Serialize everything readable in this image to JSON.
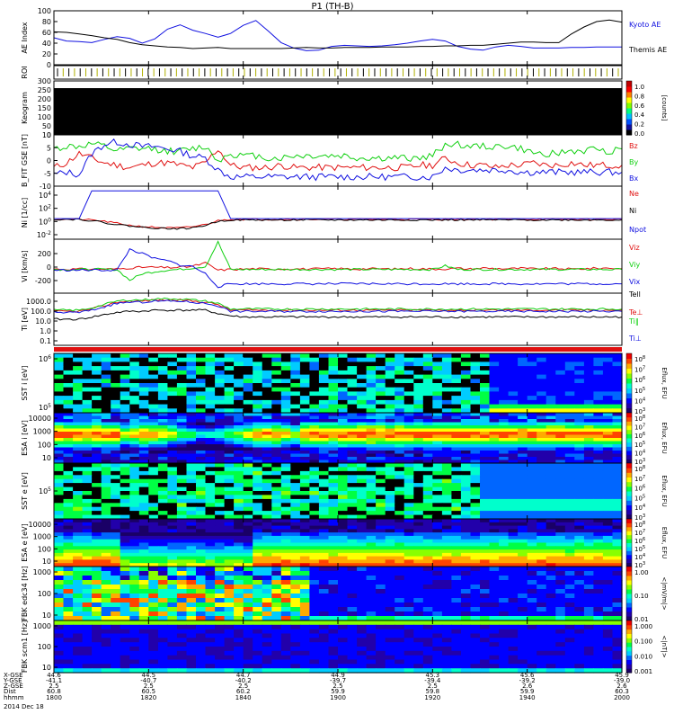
{
  "title": "P1 (TH-B)",
  "colors": {
    "blue": "#1010e0",
    "red": "#e01010",
    "green": "#10d010",
    "black": "#000000",
    "magenta": "#ff00ff",
    "yellow": "#d8d800"
  },
  "chart_data": [
    {
      "name": "ae-index",
      "type": "line",
      "ylabel": "AE Index",
      "ylim": [
        0,
        100
      ],
      "yticks": [
        "100",
        "80",
        "60",
        "40",
        "20",
        "0"
      ],
      "series": [
        {
          "name": "Kyoto AE",
          "color": "blue",
          "values": [
            50,
            44,
            43,
            41,
            47,
            52,
            49,
            40,
            48,
            66,
            74,
            64,
            58,
            51,
            58,
            73,
            82,
            62,
            41,
            31,
            26,
            27,
            34,
            36,
            35,
            34,
            35,
            37,
            40,
            44,
            47,
            44,
            34,
            29,
            27,
            33,
            36,
            34,
            31,
            31,
            31,
            32,
            32,
            33,
            33,
            33
          ]
        },
        {
          "name": "Themis AE",
          "color": "black",
          "values": [
            61,
            60,
            57,
            54,
            50,
            47,
            41,
            37,
            35,
            33,
            32,
            30,
            31,
            32,
            30,
            30,
            30,
            30,
            30,
            31,
            32,
            31,
            31,
            32,
            32,
            32,
            33,
            33,
            33,
            34,
            34,
            35,
            35,
            36,
            36,
            38,
            40,
            42,
            42,
            41,
            41,
            57,
            70,
            80,
            83,
            79
          ]
        }
      ]
    },
    {
      "name": "roi",
      "type": "table",
      "ylabel": "ROI"
    },
    {
      "name": "keogram",
      "type": "heatmap",
      "ylabel": "Keogram",
      "yticks": [
        "300",
        "250",
        "200",
        "150",
        "100",
        "50",
        "0"
      ],
      "colorbar": {
        "ticks": [
          "1.0",
          "0.8",
          "0.6",
          "0.4",
          "0.2",
          "0.0"
        ],
        "label": "[counts]"
      }
    },
    {
      "name": "b-field",
      "type": "line",
      "ylabel": "B_FIT GSE [nT]",
      "yticks": [
        "10",
        "5",
        "0",
        "-5",
        "-10"
      ],
      "series": [
        {
          "name": "Bz",
          "color": "red",
          "values": [
            -3,
            -1,
            3,
            1,
            -1,
            -2,
            -3,
            -2,
            -1,
            -1,
            -2,
            -3,
            -1,
            5,
            -2,
            -3,
            -3,
            -3,
            -2,
            -3,
            -3,
            -3,
            -3,
            -3,
            -3,
            -3,
            -3,
            -3,
            -3,
            -2,
            -2,
            1,
            -1,
            -2,
            -2,
            -3,
            -2,
            -2,
            -1,
            -2,
            -2,
            -1,
            -2,
            -2,
            -2,
            -2
          ]
        },
        {
          "name": "By",
          "color": "green",
          "values": [
            5,
            6,
            6,
            7,
            6,
            4,
            5,
            5,
            5,
            4,
            4,
            5,
            6,
            0,
            3,
            2,
            2,
            1,
            1,
            2,
            2,
            2,
            2,
            2,
            1,
            1,
            1,
            1,
            1,
            1,
            2,
            7,
            7,
            6,
            6,
            6,
            6,
            5,
            3,
            3,
            3,
            4,
            4,
            5,
            4,
            5
          ]
        },
        {
          "name": "Bx",
          "color": "blue",
          "values": [
            -6,
            -5,
            -6,
            3,
            7,
            8,
            7,
            6,
            6,
            5,
            4,
            2,
            1,
            -4,
            -7,
            -7,
            -7,
            -7,
            -7,
            -7,
            -7,
            -7,
            -7,
            -7,
            -7,
            -7,
            -7,
            -7,
            -7,
            -7,
            -7,
            -3,
            -4,
            -4,
            -4,
            -4,
            -4,
            -5,
            -5,
            -5,
            -5,
            -5,
            -5,
            -5,
            -5,
            -5
          ]
        }
      ]
    },
    {
      "name": "density",
      "type": "line",
      "ylabel": "Ni [1/cc]",
      "yunit": "[1/cc]",
      "yticks": [
        "10^4",
        "10^2",
        "10^0",
        "10^-2"
      ],
      "series": [
        {
          "name": "Ne",
          "color": "red",
          "values": [
            0,
            0,
            0,
            -0.1,
            -0.3,
            -0.6,
            -0.9,
            -1.1,
            -1.2,
            -1.3,
            -1.3,
            -1.1,
            -0.8,
            -0.2,
            0,
            0,
            0,
            0,
            0,
            0,
            0,
            0,
            0,
            0,
            0,
            0,
            0,
            0,
            0,
            0,
            0,
            0,
            0,
            0,
            0,
            0,
            0,
            0,
            0,
            0,
            0,
            0,
            0,
            0,
            0,
            0
          ]
        },
        {
          "name": "Ni",
          "color": "black",
          "values": [
            0,
            0,
            0,
            -0.2,
            -0.5,
            -0.8,
            -1.0,
            -1.2,
            -1.3,
            -1.4,
            -1.4,
            -1.3,
            -0.9,
            -0.3,
            -0.1,
            -0.1,
            -0.1,
            -0.1,
            -0.1,
            -0.1,
            -0.1,
            -0.1,
            -0.1,
            -0.1,
            -0.1,
            -0.1,
            -0.1,
            -0.1,
            -0.1,
            -0.1,
            -0.1,
            -0.1,
            -0.1,
            -0.1,
            -0.1,
            -0.1,
            -0.1,
            -0.1,
            -0.1,
            -0.1,
            -0.1,
            -0.1,
            -0.1,
            -0.1,
            -0.1,
            -0.1
          ]
        },
        {
          "name": "Npot",
          "color": "blue",
          "values": [
            0.1,
            0.1,
            0.1,
            4.3,
            4.3,
            4.3,
            4.3,
            4.3,
            4.3,
            4.3,
            4.3,
            4.3,
            4.3,
            4.3,
            0.1,
            0.1,
            0.1,
            0.1,
            0.1,
            0.1,
            0.1,
            0.1,
            0.1,
            0.1,
            0.1,
            0.1,
            0.1,
            0.1,
            0.1,
            0.1,
            0.1,
            0.1,
            0.1,
            0.1,
            0.1,
            0.1,
            0.1,
            0.1,
            0.1,
            0.1,
            0.1,
            0.1,
            0.1,
            0.1,
            0.1,
            0.1
          ]
        }
      ]
    },
    {
      "name": "velocity",
      "type": "line",
      "ylabel": "Vi [km/s]",
      "yticks": [
        "200",
        "0",
        "-200"
      ],
      "series": [
        {
          "name": "Viz",
          "color": "red",
          "values": [
            5,
            4,
            5,
            3,
            4,
            6,
            20,
            30,
            30,
            25,
            30,
            45,
            90,
            -10,
            0,
            5,
            10,
            5,
            8,
            10,
            5,
            8,
            12,
            10,
            5,
            10,
            8,
            5,
            12,
            10,
            5,
            8,
            15,
            5,
            20,
            12,
            10,
            15,
            8,
            10,
            12,
            5,
            10,
            15,
            20,
            10
          ]
        },
        {
          "name": "Viy",
          "color": "green",
          "values": [
            0,
            -2,
            0,
            2,
            0,
            -2,
            -150,
            -60,
            -30,
            -10,
            0,
            20,
            40,
            380,
            0,
            0,
            0,
            0,
            0,
            0,
            0,
            0,
            0,
            0,
            0,
            0,
            0,
            0,
            0,
            0,
            0,
            50,
            0,
            0,
            0,
            0,
            0,
            0,
            0,
            0,
            0,
            0,
            0,
            0,
            0,
            0
          ]
        },
        {
          "name": "Vix",
          "color": "blue",
          "values": [
            -10,
            -10,
            -10,
            -10,
            -10,
            -10,
            280,
            220,
            150,
            120,
            60,
            40,
            -60,
            -240,
            -200,
            -200,
            -200,
            -200,
            -200,
            -200,
            -200,
            -200,
            -200,
            -200,
            -200,
            -200,
            -200,
            -200,
            -200,
            -200,
            -200,
            -200,
            -200,
            -200,
            -200,
            -200,
            -200,
            -200,
            -200,
            -200,
            -200,
            -200,
            -200,
            -200,
            -200,
            -200
          ]
        }
      ]
    },
    {
      "name": "temperature",
      "type": "line",
      "ylabel": "Ti [eV]",
      "yticks": [
        "1000.0",
        "100.0",
        "10.0",
        "1.0",
        "0.1"
      ],
      "series": [
        {
          "name": "Tell",
          "color": "black",
          "values": [
            1.0,
            1.0,
            1.0,
            1.2,
            1.4,
            1.6,
            1.7,
            1.7,
            1.8,
            1.8,
            1.8,
            1.8,
            1.8,
            1.5,
            1.3,
            1.2,
            1.2,
            1.2,
            1.2,
            1.2,
            1.2,
            1.2,
            1.2,
            1.2,
            1.2,
            1.2,
            1.2,
            1.2,
            1.2,
            1.2,
            1.2,
            1.2,
            1.2,
            1.2,
            1.2,
            1.2,
            1.2,
            1.2,
            1.2,
            1.2,
            1.2,
            1.2,
            1.2,
            1.2,
            1.2,
            1.2
          ]
        },
        {
          "name": "Te⊥",
          "color": "red",
          "values": [
            1.7,
            1.7,
            1.7,
            1.9,
            2.2,
            2.5,
            2.6,
            2.6,
            2.7,
            2.7,
            2.7,
            2.6,
            2.5,
            2.3,
            1.8,
            1.8,
            1.8,
            1.8,
            1.8,
            1.8,
            1.8,
            1.8,
            1.8,
            1.8,
            1.8,
            1.8,
            1.8,
            1.8,
            1.8,
            1.8,
            1.8,
            1.8,
            1.8,
            1.8,
            1.8,
            1.8,
            1.8,
            1.8,
            1.8,
            1.8,
            1.8,
            1.8,
            1.8,
            1.8,
            1.8,
            1.8
          ]
        },
        {
          "name": "Ti‖",
          "color": "green",
          "values": [
            1.8,
            1.8,
            1.8,
            2.0,
            2.3,
            2.6,
            2.7,
            2.7,
            2.8,
            2.8,
            2.8,
            2.7,
            2.6,
            2.4,
            1.9,
            1.9,
            1.9,
            1.9,
            1.9,
            1.9,
            1.9,
            1.9,
            1.9,
            1.9,
            1.9,
            1.9,
            1.9,
            1.9,
            1.9,
            1.9,
            1.9,
            1.9,
            1.9,
            1.9,
            1.9,
            1.9,
            1.9,
            1.9,
            1.9,
            1.9,
            1.9,
            1.9,
            1.9,
            1.9,
            1.9,
            1.9
          ]
        },
        {
          "name": "Ti⊥",
          "color": "blue",
          "values": [
            1.6,
            1.6,
            1.6,
            1.8,
            2.1,
            2.4,
            2.5,
            2.5,
            2.6,
            2.6,
            2.6,
            2.5,
            2.4,
            2.2,
            1.7,
            1.7,
            1.7,
            1.7,
            1.7,
            1.7,
            1.7,
            1.7,
            1.7,
            1.7,
            1.7,
            1.7,
            1.7,
            1.7,
            1.7,
            1.7,
            1.7,
            1.7,
            1.7,
            1.7,
            1.7,
            1.7,
            1.7,
            1.7,
            1.7,
            1.7,
            1.7,
            1.7,
            1.7,
            1.7,
            1.7,
            1.7
          ]
        }
      ]
    },
    {
      "name": "sst-i",
      "type": "heatmap",
      "ylabel": "SST i [eV]",
      "yticks": [
        "10^6",
        "10^5"
      ],
      "colorbar": {
        "ticks": [
          "10^8",
          "10^7",
          "10^6",
          "10^5",
          "10^4",
          "10^3"
        ],
        "label": "Eflux, EFU"
      }
    },
    {
      "name": "esa-i",
      "type": "heatmap",
      "ylabel": "ESA i [eV]",
      "yticks": [
        "10000",
        "1000",
        "100",
        "10"
      ],
      "colorbar": {
        "ticks": [
          "10^8",
          "10^7",
          "10^6",
          "10^5",
          "10^4",
          "10^3"
        ],
        "label": "Eflux, EFU"
      }
    },
    {
      "name": "sst-e",
      "type": "heatmap",
      "ylabel": "SST e [eV]",
      "yticks": [
        "10^5"
      ],
      "colorbar": {
        "ticks": [
          "10^8",
          "10^7",
          "10^6",
          "10^5",
          "10^4",
          "10^3"
        ],
        "label": "Eflux, EFU"
      }
    },
    {
      "name": "esa-e",
      "type": "heatmap",
      "ylabel": "ESA e [eV]",
      "yticks": [
        "10000",
        "1000",
        "100",
        "10"
      ],
      "colorbar": {
        "ticks": [
          "10^8",
          "10^7",
          "10^6",
          "10^5",
          "10^4",
          "10^3"
        ],
        "label": "Eflux, EFU"
      }
    },
    {
      "name": "fbk-e",
      "type": "heatmap",
      "ylabel": "FBK edc34 [Hz]",
      "yticks": [
        "1000",
        "100",
        "10"
      ],
      "colorbar": {
        "ticks": [
          "1.00",
          "0.10",
          "0.01"
        ],
        "label": "<|mV/m|>"
      }
    },
    {
      "name": "fbk-b",
      "type": "heatmap",
      "ylabel": "FBK scm1 [Hz]",
      "yticks": [
        "1000",
        "100",
        "10"
      ],
      "colorbar": {
        "ticks": [
          "1.000",
          "0.100",
          "0.010",
          "0.001"
        ],
        "label": "<|nT|>"
      }
    }
  ],
  "xaxis": {
    "row_labels": [
      "X-GSE",
      "Y-GSE",
      "Z-GSE",
      "Dist",
      "hhmm"
    ],
    "columns": [
      {
        "x": "44.6",
        "y": "-41.1",
        "z": "2.5",
        "d": "60.8",
        "t": "1800"
      },
      {
        "x": "44.5",
        "y": "-40.7",
        "z": "2.5",
        "d": "60.5",
        "t": "1820"
      },
      {
        "x": "44.7",
        "y": "-40.2",
        "z": "2.5",
        "d": "60.2",
        "t": "1840"
      },
      {
        "x": "44.9",
        "y": "-39.7",
        "z": "2.5",
        "d": "59.9",
        "t": "1900"
      },
      {
        "x": "45.3",
        "y": "-39.4",
        "z": "2.5",
        "d": "59.8",
        "t": "1920"
      },
      {
        "x": "45.6",
        "y": "-39.2",
        "z": "2.6",
        "d": "59.9",
        "t": "1940"
      },
      {
        "x": "45.9",
        "y": "-39.0",
        "z": "2.6",
        "d": "60.3",
        "t": "2000"
      }
    ],
    "date": "2014 Dec 18"
  }
}
